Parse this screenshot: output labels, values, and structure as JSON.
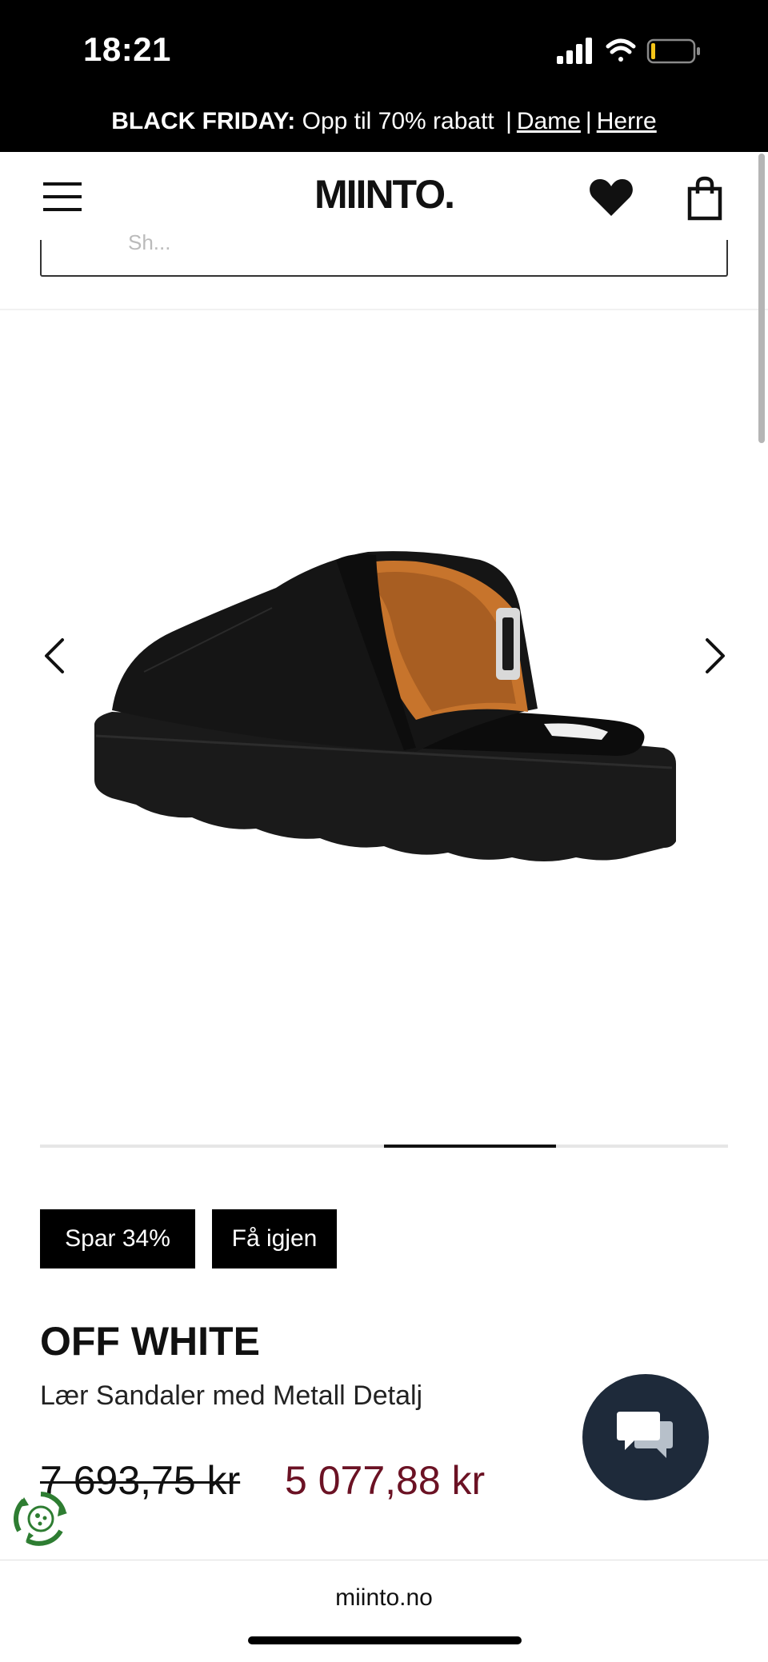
{
  "status_bar": {
    "time": "18:21",
    "icons": [
      "signal-icon",
      "wifi-icon",
      "battery-icon"
    ]
  },
  "promo": {
    "label": "BLACK FRIDAY:",
    "text": "Opp til 70% rabatt",
    "link_women": "Dame",
    "link_men": "Herre"
  },
  "header": {
    "logo": "MIINTO.",
    "icons": [
      "menu-icon",
      "heart-icon",
      "bag-icon"
    ]
  },
  "search": {
    "text": "Sh..."
  },
  "gallery": {
    "image_alt": "Black suede platform mule sandal with metal buckle",
    "active_slide": 3,
    "slide_count": 4,
    "icons": [
      "chevron-left-icon",
      "chevron-right-icon"
    ]
  },
  "badges": {
    "discount": "Spar 34%",
    "return": "Få igjen"
  },
  "product": {
    "brand": "OFF WHITE",
    "name": "Lær Sandaler med Metall Detalj",
    "price_old": "7 693,75 kr",
    "price_new": "5 077,88 kr"
  },
  "colors": {
    "accent_price": "#6b1224",
    "chat_bg": "#1e2a3a",
    "eco_green": "#2e7d32"
  },
  "browser": {
    "url": "miinto.no"
  }
}
